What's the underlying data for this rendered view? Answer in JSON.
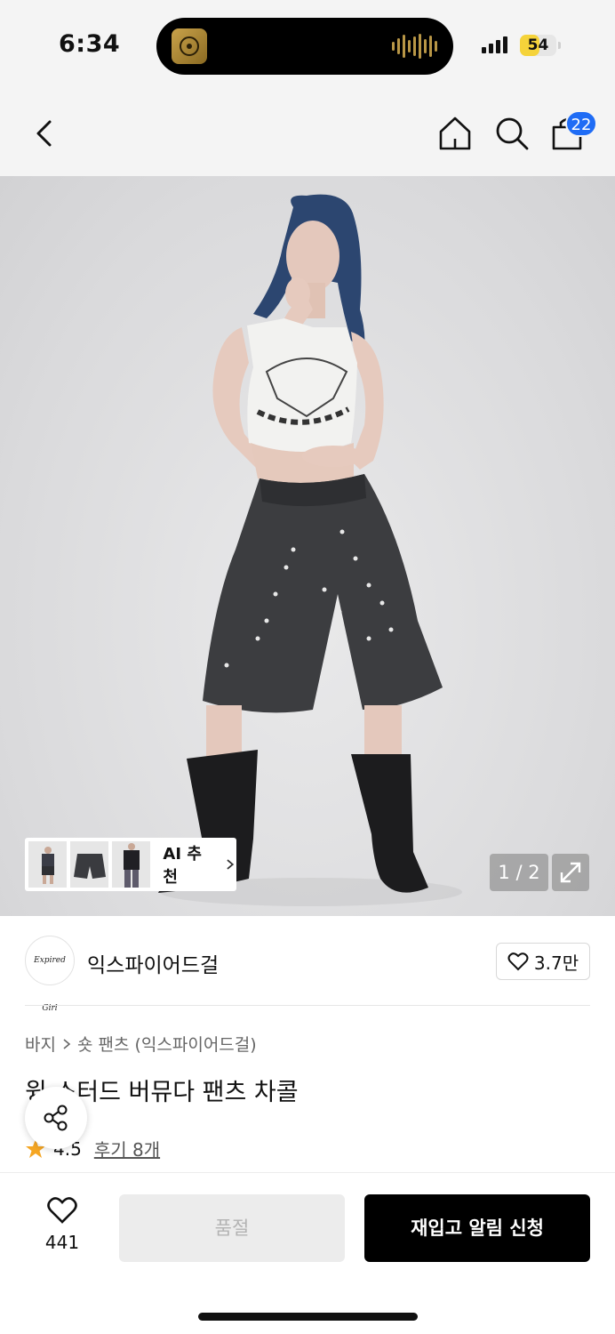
{
  "status_bar": {
    "time": "6:34",
    "battery": "54",
    "battery_fraction": 0.54,
    "battery_color": "#f5d33a"
  },
  "nav": {
    "cart_count": "22",
    "badge_color": "#1f6cf5"
  },
  "gallery": {
    "ai_label": "AI 추천",
    "page_counter": "1 / 2"
  },
  "brand": {
    "name": "익스파이어드걸",
    "logo_text": "Expired Girl",
    "likes": "3.7만"
  },
  "product": {
    "breadcrumb": [
      "바지",
      "숏 팬츠 (익스파이어드걸)"
    ],
    "title": "윙 스터드 버뮤다 팬츠 차콜",
    "rating": "4.5",
    "reviews": "후기 8개"
  },
  "bottom": {
    "like_count": "441",
    "soldout_label": "품절",
    "restock_label": "재입고 알림 신청"
  }
}
